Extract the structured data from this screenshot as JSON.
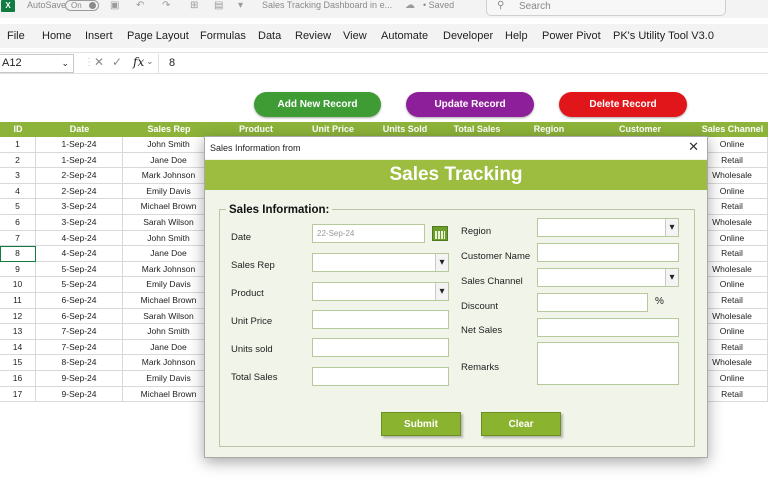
{
  "titlebar": {
    "app_icon": "X",
    "autosave_label": "AutoSave",
    "autosave_state": "On",
    "document_title": "Sales Tracking Dashboard in e...",
    "saved_status": "• Saved",
    "search_placeholder": "Search"
  },
  "menu": [
    "File",
    "Home",
    "Insert",
    "Page Layout",
    "Formulas",
    "Data",
    "Review",
    "View",
    "Automate",
    "Developer",
    "Help",
    "Power Pivot",
    "PK's Utility Tool V3.0"
  ],
  "formula_bar": {
    "name_box": "A12",
    "fx_label": "fx",
    "value": "8"
  },
  "sheet_buttons": {
    "add": "Add New Record",
    "update": "Update Record",
    "delete": "Delete Record"
  },
  "table": {
    "headers": [
      "ID",
      "Date",
      "Sales Rep",
      "Product",
      "Unit Price",
      "Units Sold",
      "Total Sales",
      "Region",
      "Customer",
      "Sales Channel"
    ],
    "rows": [
      [
        "1",
        "1-Sep-24",
        "John Smith",
        "Online"
      ],
      [
        "2",
        "1-Sep-24",
        "Jane Doe",
        "Retail"
      ],
      [
        "3",
        "2-Sep-24",
        "Mark Johnson",
        "Wholesale"
      ],
      [
        "4",
        "2-Sep-24",
        "Emily Davis",
        "Online"
      ],
      [
        "5",
        "3-Sep-24",
        "Michael Brown",
        "Retail"
      ],
      [
        "6",
        "3-Sep-24",
        "Sarah Wilson",
        "Wholesale"
      ],
      [
        "7",
        "4-Sep-24",
        "John Smith",
        "Online"
      ],
      [
        "8",
        "4-Sep-24",
        "Jane Doe",
        "Retail"
      ],
      [
        "9",
        "5-Sep-24",
        "Mark Johnson",
        "Wholesale"
      ],
      [
        "10",
        "5-Sep-24",
        "Emily Davis",
        "Online"
      ],
      [
        "11",
        "6-Sep-24",
        "Michael Brown",
        "Retail"
      ],
      [
        "12",
        "6-Sep-24",
        "Sarah Wilson",
        "Wholesale"
      ],
      [
        "13",
        "7-Sep-24",
        "John Smith",
        "Online"
      ],
      [
        "14",
        "7-Sep-24",
        "Jane Doe",
        "Retail"
      ],
      [
        "15",
        "8-Sep-24",
        "Mark Johnson",
        "Wholesale"
      ],
      [
        "16",
        "9-Sep-24",
        "Emily Davis",
        "Online"
      ],
      [
        "17",
        "9-Sep-24",
        "Michael Brown",
        "Retail"
      ]
    ]
  },
  "dialog": {
    "window_title": "Sales Information from",
    "close_glyph": "✕",
    "banner": "Sales Tracking",
    "section_title": "Sales Information:",
    "labels": {
      "date": "Date",
      "sales_rep": "Sales Rep",
      "product": "Product",
      "unit_price": "Unit Price",
      "units_sold": "Units sold",
      "total_sales": "Total Sales",
      "region": "Region",
      "customer_name": "Customer Name",
      "sales_channel": "Sales Channel",
      "discount": "Discount",
      "net_sales": "Net Sales",
      "remarks": "Remarks"
    },
    "date_value": "22-Sep-24",
    "discount_unit": "%",
    "submit": "Submit",
    "clear": "Clear"
  },
  "colors": {
    "header_green": "#8db33a",
    "add_button": "#3f9c35",
    "update_button": "#8e1f9a",
    "delete_button": "#e0161b",
    "banner_green": "#9cbd3f"
  },
  "icons": [
    "excel-icon",
    "save-icon",
    "undo-icon",
    "redo-icon",
    "search-icon",
    "calendar-icon",
    "close-icon"
  ]
}
